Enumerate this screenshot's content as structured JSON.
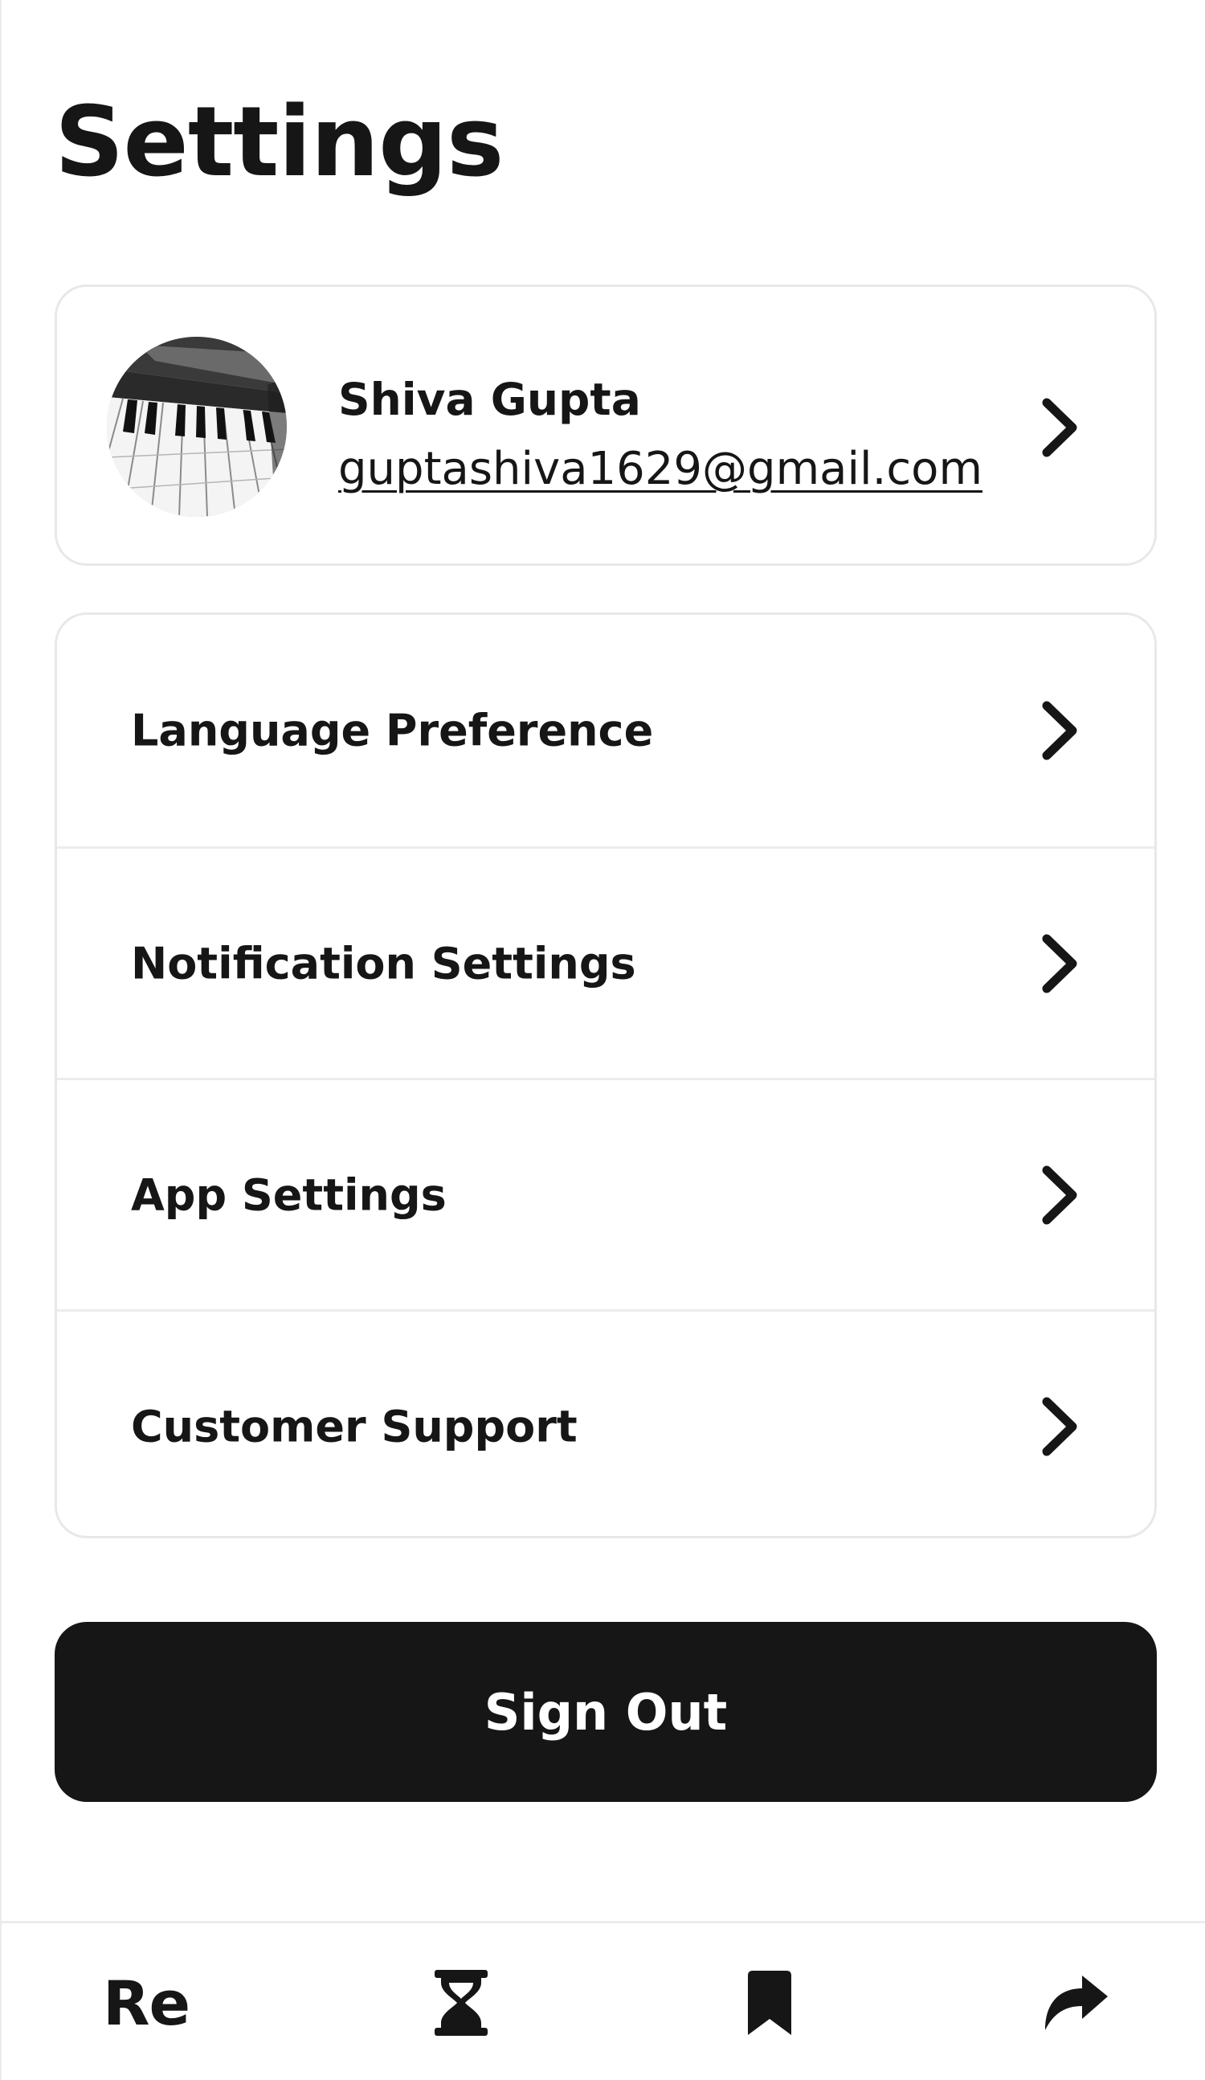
{
  "page": {
    "title": "Settings"
  },
  "profile": {
    "name": "Shiva Gupta",
    "email": "guptashiva1629@gmail.com",
    "avatar_icon": "piano-keys-photo"
  },
  "menu": {
    "items": [
      {
        "label": "Language Preference",
        "icon": "chevron-right-icon"
      },
      {
        "label": "Notification Settings",
        "icon": "chevron-right-icon"
      },
      {
        "label": "App Settings",
        "icon": "chevron-right-icon"
      },
      {
        "label": "Customer Support",
        "icon": "chevron-right-icon"
      }
    ]
  },
  "actions": {
    "sign_out_label": "Sign Out"
  },
  "bottom_nav": {
    "logo_text": "Re",
    "tabs": [
      {
        "icon": "app-logo"
      },
      {
        "icon": "hourglass-icon"
      },
      {
        "icon": "bookmark-icon"
      },
      {
        "icon": "share-icon"
      }
    ]
  },
  "colors": {
    "background": "#ffffff",
    "text": "#161616",
    "border": "#e8e8e8",
    "button": "#161616",
    "button_text": "#ffffff"
  }
}
